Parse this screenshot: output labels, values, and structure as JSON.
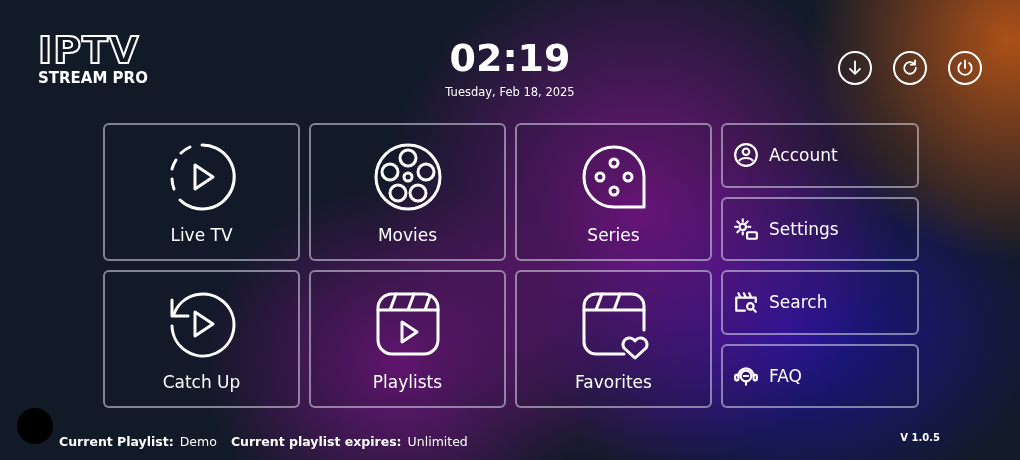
{
  "logo": {
    "title": "IPTV",
    "subtitle": "STREAM PRO"
  },
  "clock": {
    "time": "02:19",
    "date": "Tuesday, Feb 18, 2025"
  },
  "top_actions": [
    {
      "kind": "download"
    },
    {
      "kind": "refresh"
    },
    {
      "kind": "power"
    }
  ],
  "tiles": [
    {
      "kind": "live",
      "label": "Live TV"
    },
    {
      "kind": "movies",
      "label": "Movies"
    },
    {
      "kind": "series",
      "label": "Series"
    },
    {
      "kind": "catchup",
      "label": "Catch Up"
    },
    {
      "kind": "playlists",
      "label": "Playlists"
    },
    {
      "kind": "favorites",
      "label": "Favorites"
    }
  ],
  "side_buttons": [
    {
      "kind": "account",
      "label": "Account"
    },
    {
      "kind": "settings",
      "label": "Settings"
    },
    {
      "kind": "search",
      "label": "Search"
    },
    {
      "kind": "faq",
      "label": "FAQ"
    }
  ],
  "footer": {
    "items": [
      {
        "label": "Current Playlist:",
        "value": "Demo"
      },
      {
        "label": "Current playlist expires:",
        "value": "Unlimited"
      }
    ],
    "version": "V 1.0.5"
  }
}
